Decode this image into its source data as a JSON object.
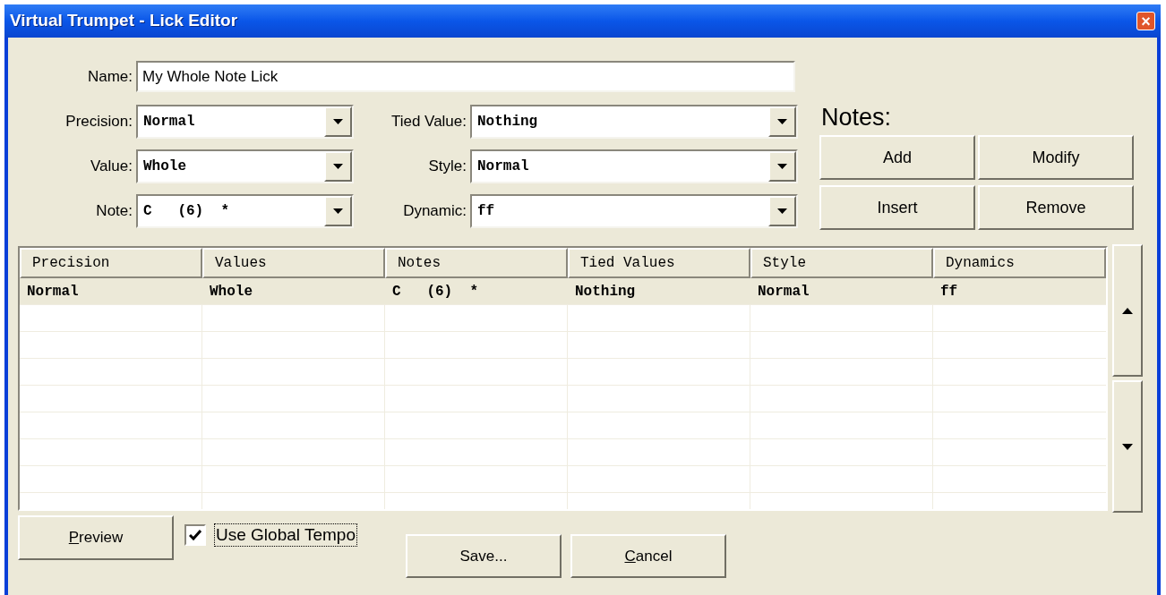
{
  "window": {
    "title": "Virtual Trumpet - Lick Editor",
    "close": "×"
  },
  "name_field": {
    "label": "Name:",
    "value": "My Whole Note Lick"
  },
  "left_fields": [
    {
      "label": "Precision:",
      "value": "Normal"
    },
    {
      "label": "Value:",
      "value": "Whole"
    },
    {
      "label": "Note:",
      "value": "C   (6)  *"
    }
  ],
  "right_fields": [
    {
      "label": "Tied Value:",
      "value": "Nothing"
    },
    {
      "label": "Style:",
      "value": "Normal"
    },
    {
      "label": "Dynamic:",
      "value": "ff"
    }
  ],
  "notes": {
    "heading": "Notes:",
    "buttons": [
      "Add",
      "Modify",
      "Insert",
      "Remove"
    ]
  },
  "table": {
    "columns": [
      "Precision",
      "Values",
      "Notes",
      "Tied Values",
      "Style",
      "Dynamics"
    ],
    "rows": [
      {
        "selected": true,
        "cells": [
          "Normal",
          "Whole",
          "C   (6)  *",
          "Nothing",
          "Normal",
          "ff"
        ]
      }
    ]
  },
  "bottom": {
    "preview": {
      "label": "Preview",
      "access_key": true
    },
    "global_tempo": {
      "label": "Use Global Tempo",
      "checked": true,
      "focused": true
    },
    "save": {
      "label": "Save...",
      "access_key": false
    },
    "cancel": {
      "label": "Cancel",
      "access_key": true
    }
  }
}
